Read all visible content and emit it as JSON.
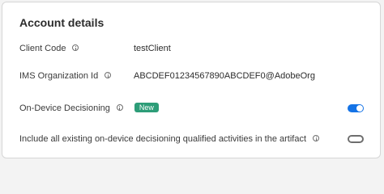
{
  "section_title": "Account details",
  "client_code": {
    "label": "Client Code",
    "value": "testClient"
  },
  "ims_org": {
    "label": "IMS Organization Id",
    "value": "ABCDEF01234567890ABCDEF0@AdobeOrg"
  },
  "on_device": {
    "label": "On-Device Decisioning",
    "badge": "New",
    "enabled": true
  },
  "include_activities": {
    "label": "Include all existing on-device decisioning qualified activities in the artifact",
    "enabled": false
  },
  "colors": {
    "toggle_on": "#1473e6",
    "badge": "#2d9d78"
  },
  "icons": {
    "info": "info-icon"
  }
}
